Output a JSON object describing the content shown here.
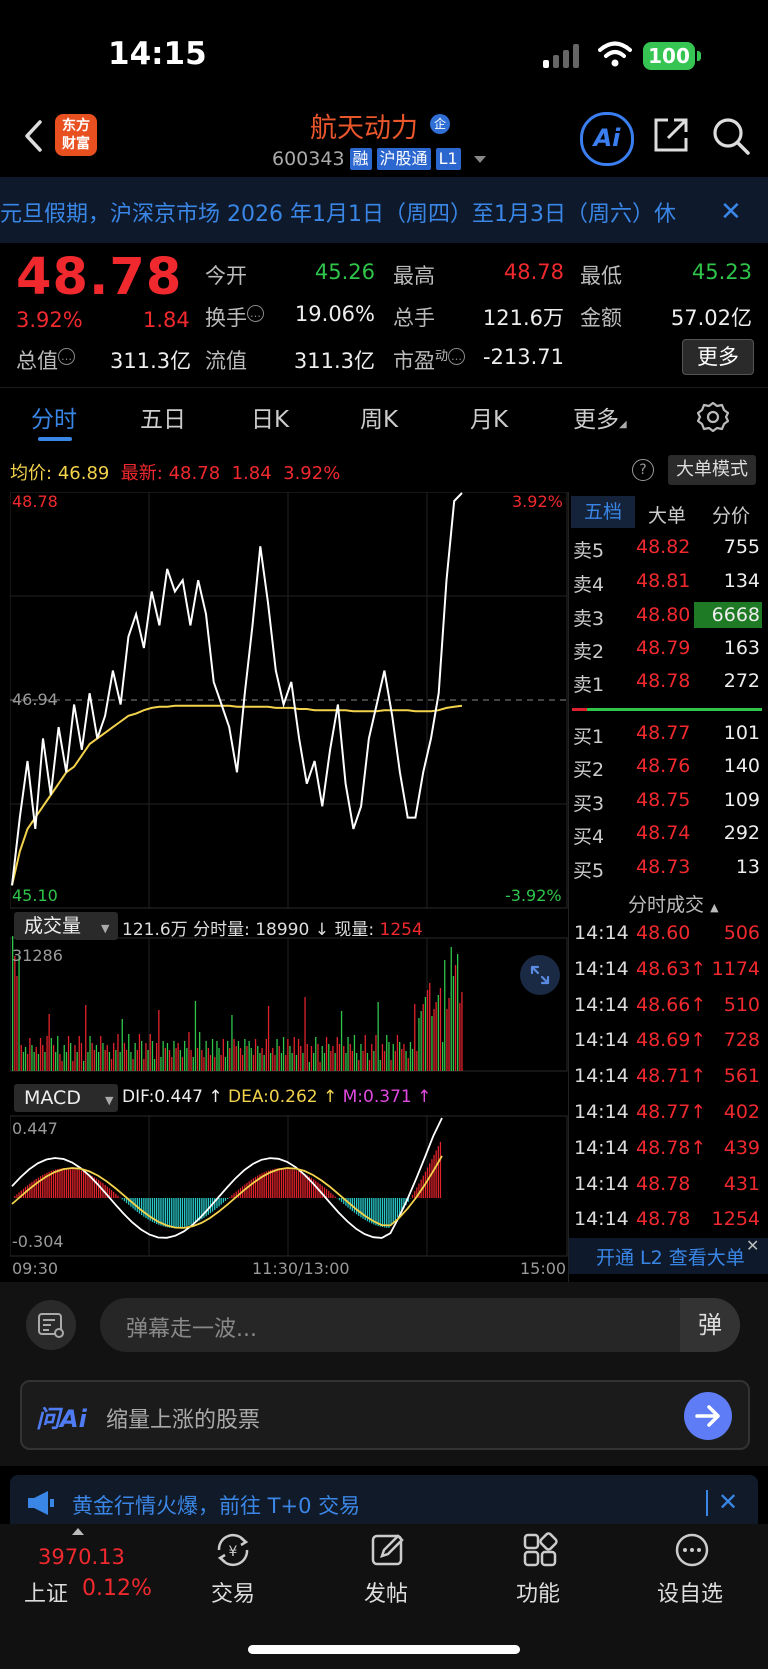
{
  "status": {
    "time": "14:15",
    "battery": "100"
  },
  "header": {
    "logo_line1": "东方",
    "logo_line2": "财富",
    "name": "航天动力",
    "name_badge": "企",
    "code": "600343",
    "tags": [
      "融",
      "沪股通",
      "L1"
    ],
    "ai_label": "Ai"
  },
  "notice": {
    "text": "元旦假期，沪深京市场 2026 年1月1日（周四）至1月3日（周六）休",
    "close": "✕"
  },
  "quote": {
    "price": "48.78",
    "pct": "3.92%",
    "change": "1.84",
    "mcap_label": "总值",
    "mcap": "311.3亿",
    "rows": [
      [
        {
          "l": "今开",
          "v": "45.26",
          "c": "green"
        },
        {
          "l": "最高",
          "v": "48.78",
          "c": "red"
        },
        {
          "l": "最低",
          "v": "45.23",
          "c": "green"
        }
      ],
      [
        {
          "l": "换手",
          "v": "19.06%",
          "c": "white"
        },
        {
          "l": "总手",
          "v": "121.6万",
          "c": "white"
        },
        {
          "l": "金额",
          "v": "57.02亿",
          "c": "white"
        }
      ],
      [
        {
          "l": "流值",
          "v": "311.3亿",
          "c": "white"
        },
        {
          "l": "市盈",
          "v": "-213.71",
          "c": "white"
        }
      ]
    ],
    "pe_sup": "动",
    "more": "更多"
  },
  "tabs": [
    "分时",
    "五日",
    "日K",
    "周K",
    "月K",
    "更多"
  ],
  "avg_row": {
    "avg_label": "均价:",
    "avg": "46.89",
    "latest_label": "最新:",
    "latest": "48.78",
    "chg": "1.84",
    "pct": "3.92%",
    "big_order": "大单模式",
    "help": "?"
  },
  "chart_axes": {
    "top_price": "48.78",
    "mid_price": "46.94",
    "bottom_price": "45.10",
    "top_pct": "3.92%",
    "bottom_pct": "-3.92%",
    "t_start": "09:30",
    "t_mid": "11:30/13:00",
    "t_end": "15:00"
  },
  "chart_data": {
    "type": "line",
    "ylim": [
      45.1,
      48.78
    ],
    "x_labels": [
      "09:30",
      "11:30/13:00",
      "15:00"
    ],
    "series": [
      {
        "name": "最新",
        "color": "#ffffff",
        "values": [
          45.3,
          45.9,
          46.4,
          45.8,
          46.6,
          46.1,
          46.7,
          46.3,
          46.9,
          46.5,
          47.0,
          46.6,
          46.8,
          47.2,
          46.9,
          47.5,
          47.7,
          47.4,
          47.9,
          47.6,
          48.1,
          47.9,
          48.0,
          47.6,
          48.0,
          47.7,
          47.1,
          46.9,
          46.7,
          46.3,
          47.0,
          47.6,
          48.3,
          47.8,
          47.2,
          46.9,
          47.1,
          46.6,
          46.2,
          46.4,
          46.0,
          46.5,
          46.9,
          46.2,
          45.8,
          46.0,
          46.6,
          46.9,
          47.2,
          46.8,
          46.3,
          45.9,
          45.9,
          46.3,
          46.6,
          47.0,
          48.0,
          48.7,
          48.78
        ]
      },
      {
        "name": "均价",
        "color": "#f3d24c",
        "values": [
          45.3,
          45.6,
          45.8,
          45.9,
          46.0,
          46.1,
          46.2,
          46.3,
          46.35,
          46.45,
          46.55,
          46.6,
          46.65,
          46.7,
          46.75,
          46.8,
          46.82,
          46.85,
          46.87,
          46.88,
          46.88,
          46.89,
          46.89,
          46.89,
          46.89,
          46.89,
          46.89,
          46.89,
          46.89,
          46.88,
          46.88,
          46.88,
          46.88,
          46.88,
          46.87,
          46.87,
          46.87,
          46.86,
          46.86,
          46.85,
          46.85,
          46.85,
          46.85,
          46.85,
          46.84,
          46.84,
          46.84,
          46.84,
          46.85,
          46.85,
          46.85,
          46.85,
          46.84,
          46.84,
          46.84,
          46.85,
          46.87,
          46.88,
          46.89
        ]
      }
    ]
  },
  "orderbook": {
    "tabs": [
      "五档",
      "大单",
      "分价"
    ],
    "asks": [
      {
        "l": "卖5",
        "p": "48.82",
        "v": "755"
      },
      {
        "l": "卖4",
        "p": "48.81",
        "v": "134"
      },
      {
        "l": "卖3",
        "p": "48.80",
        "v": "6668"
      },
      {
        "l": "卖2",
        "p": "48.79",
        "v": "163"
      },
      {
        "l": "卖1",
        "p": "48.78",
        "v": "272"
      }
    ],
    "bids": [
      {
        "l": "买1",
        "p": "48.77",
        "v": "101"
      },
      {
        "l": "买2",
        "p": "48.76",
        "v": "140"
      },
      {
        "l": "买3",
        "p": "48.75",
        "v": "109"
      },
      {
        "l": "买4",
        "p": "48.74",
        "v": "292"
      },
      {
        "l": "买5",
        "p": "48.73",
        "v": "13"
      }
    ],
    "trades_title": "分时成交",
    "trades": [
      {
        "t": "14:14",
        "p": "48.60",
        "v": "506"
      },
      {
        "t": "14:14",
        "p": "48.63↑",
        "v": "1174"
      },
      {
        "t": "14:14",
        "p": "48.66↑",
        "v": "510"
      },
      {
        "t": "14:14",
        "p": "48.69↑",
        "v": "728"
      },
      {
        "t": "14:14",
        "p": "48.71↑",
        "v": "561"
      },
      {
        "t": "14:14",
        "p": "48.77↑",
        "v": "402"
      },
      {
        "t": "14:14",
        "p": "48.78↑",
        "v": "439"
      },
      {
        "t": "14:14",
        "p": "48.78",
        "v": "431"
      },
      {
        "t": "14:14",
        "p": "48.78",
        "v": "1254"
      }
    ],
    "l2": "开通 L2 查看大单",
    "l2_close": "✕"
  },
  "volume": {
    "selector": "成交量",
    "total": "121.6万",
    "seg_label": "分时量:",
    "seg": "18990",
    "now_label": "现量:",
    "now": "1254",
    "max": "31286"
  },
  "macd": {
    "selector": "MACD",
    "dif": "DIF:0.447 ↑",
    "dea": "DEA:0.262 ↑",
    "m": "M:0.371 ↑",
    "top": "0.447",
    "bottom": "-0.304"
  },
  "comment": {
    "placeholder": "弹幕走一波...",
    "btn": "弹"
  },
  "ask_ai": {
    "label": "问Ai",
    "text": "缩量上涨的股票"
  },
  "promo": {
    "text": "黄金行情火爆，前往 T+0 交易",
    "close": "✕"
  },
  "bottom_nav": {
    "index_value": "3970.13",
    "index_name": "上证",
    "index_pct": "0.12%",
    "items": [
      "交易",
      "发帖",
      "功能",
      "设自选"
    ]
  },
  "colors": {
    "up": "#f0292e",
    "down": "#2fc54a",
    "accent": "#3a86e6",
    "avg": "#f3d24c"
  }
}
